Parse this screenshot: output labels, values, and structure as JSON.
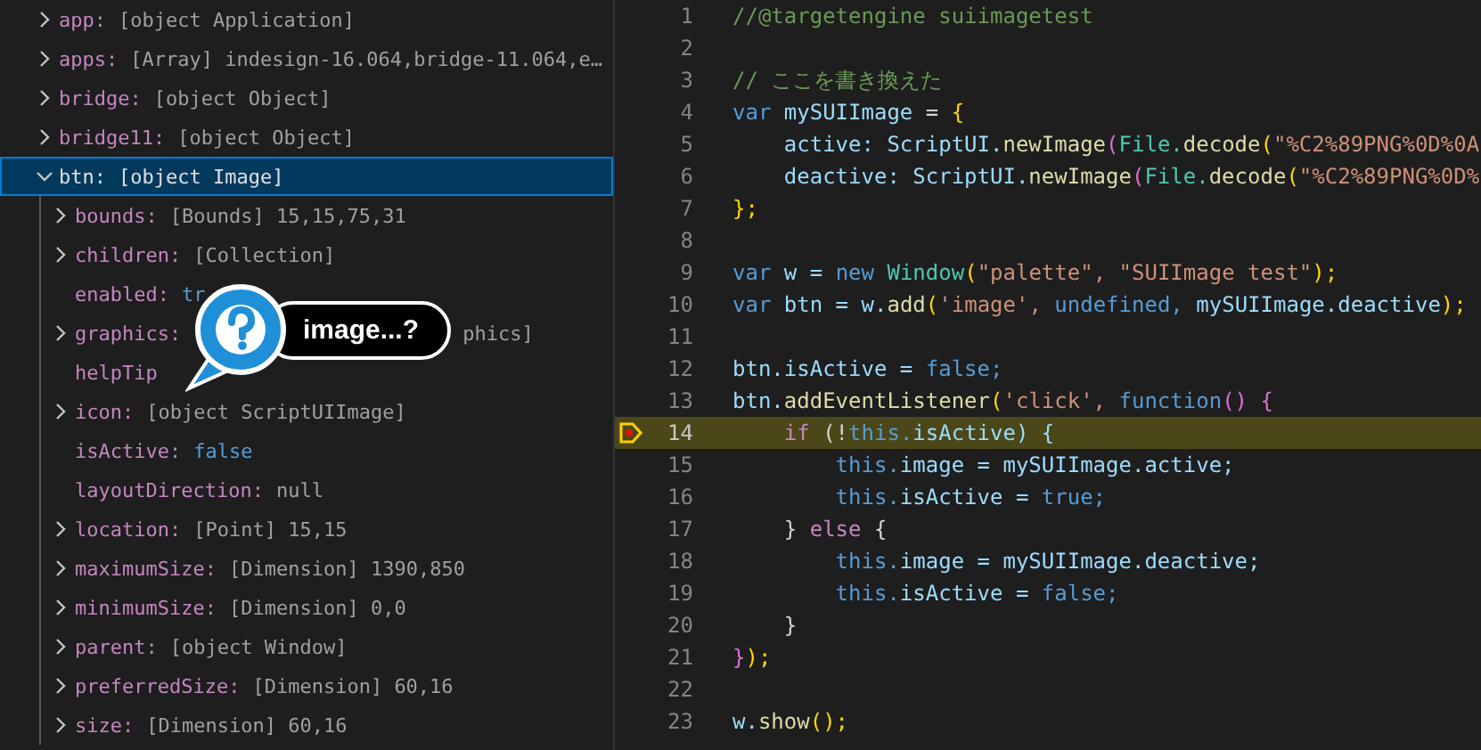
{
  "variables": [
    {
      "name": "app:",
      "value": "[object Application]",
      "expandable": true,
      "expanded": false,
      "selected": false
    },
    {
      "name": "apps:",
      "value": "[Array] indesign-16.064,bridge-11.064,e…",
      "expandable": true,
      "expanded": false,
      "selected": false
    },
    {
      "name": "bridge:",
      "value": "[object Object]",
      "expandable": true,
      "expanded": false,
      "selected": false
    },
    {
      "name": "bridge11:",
      "value": "[object Object]",
      "expandable": true,
      "expanded": false,
      "selected": false
    },
    {
      "name": "btn:",
      "value": "[object Image]",
      "expandable": true,
      "expanded": true,
      "selected": true,
      "children": [
        {
          "name": "bounds:",
          "value": "[Bounds] 15,15,75,31",
          "expandable": true,
          "kind": "text"
        },
        {
          "name": "children:",
          "value": "[Collection]",
          "expandable": true,
          "kind": "text"
        },
        {
          "name": "enabled:",
          "value": "tr",
          "expandable": false,
          "kind": "bool"
        },
        {
          "name": "graphics:",
          "value": "phics]",
          "expandable": true,
          "kind": "covered"
        },
        {
          "name": "helpTip",
          "expandable": false
        },
        {
          "name": "icon:",
          "value": "[object ScriptUIImage]",
          "expandable": true,
          "kind": "text"
        },
        {
          "name": "isActive:",
          "value": "false",
          "expandable": false,
          "kind": "bool"
        },
        {
          "name": "layoutDirection:",
          "value": "null",
          "expandable": false,
          "kind": "text"
        },
        {
          "name": "location:",
          "value": "[Point] 15,15",
          "expandable": true,
          "kind": "text"
        },
        {
          "name": "maximumSize:",
          "value": "[Dimension] 1390,850",
          "expandable": true,
          "kind": "text"
        },
        {
          "name": "minimumSize:",
          "value": "[Dimension] 0,0",
          "expandable": true,
          "kind": "text"
        },
        {
          "name": "parent:",
          "value": "[object Window]",
          "expandable": true,
          "kind": "text"
        },
        {
          "name": "preferredSize:",
          "value": "[Dimension] 60,16",
          "expandable": true,
          "kind": "text"
        },
        {
          "name": "size:",
          "value": "[Dimension] 60,16",
          "expandable": true,
          "kind": "text"
        }
      ]
    }
  ],
  "callout": {
    "text": "image...?"
  },
  "code": [
    {
      "number": "1",
      "tokens": [
        {
          "t": "//@targetengine suiimagetest",
          "kind": "comment"
        }
      ]
    },
    {
      "number": "2"
    },
    {
      "number": "3",
      "tokens": [
        {
          "t": "// ここを書き換えた",
          "kind": "comment"
        }
      ]
    },
    {
      "number": "4",
      "tokens": [
        {
          "t": "var",
          "kind": "kw"
        },
        {
          "t": " mySUIImage",
          "kind": "var"
        },
        {
          "t": " = ",
          "kind": "plain"
        },
        {
          "t": "{",
          "kind": "brace"
        }
      ]
    },
    {
      "number": "5",
      "tokens": [
        {
          "t": "    active:",
          "kind": "var"
        },
        {
          "t": " ScriptUI.",
          "kind": "var"
        },
        {
          "t": "newImage",
          "kind": "fn"
        },
        {
          "t": "(",
          "kind": "paren"
        },
        {
          "t": "File.",
          "kind": "type"
        },
        {
          "t": "decode",
          "kind": "fn"
        },
        {
          "t": "(",
          "kind": "brace"
        },
        {
          "t": "\"%C2%89PNG%0D%0A",
          "kind": "str"
        }
      ]
    },
    {
      "number": "6",
      "tokens": [
        {
          "t": "    deactive:",
          "kind": "var"
        },
        {
          "t": " ScriptUI.",
          "kind": "var"
        },
        {
          "t": "newImage",
          "kind": "fn"
        },
        {
          "t": "(",
          "kind": "paren"
        },
        {
          "t": "File.",
          "kind": "type"
        },
        {
          "t": "decode",
          "kind": "fn"
        },
        {
          "t": "(",
          "kind": "brace"
        },
        {
          "t": "\"%C2%89PNG%0D%",
          "kind": "str"
        }
      ]
    },
    {
      "number": "7",
      "tokens": [
        {
          "t": "};",
          "kind": "brace"
        }
      ]
    },
    {
      "number": "8"
    },
    {
      "number": "9",
      "tokens": [
        {
          "t": "var",
          "kind": "kw"
        },
        {
          "t": " w = ",
          "kind": "var"
        },
        {
          "t": "new",
          "kind": "kw"
        },
        {
          "t": " Window",
          "kind": "type"
        },
        {
          "t": "(",
          "kind": "brace"
        },
        {
          "t": "\"palette\",",
          "kind": "str"
        },
        {
          "t": " \"SUIImage test\"",
          "kind": "str"
        },
        {
          "t": ");",
          "kind": "brace"
        }
      ]
    },
    {
      "number": "10",
      "tokens": [
        {
          "t": "var",
          "kind": "kw"
        },
        {
          "t": " btn = w.",
          "kind": "var"
        },
        {
          "t": "add",
          "kind": "fn"
        },
        {
          "t": "(",
          "kind": "brace"
        },
        {
          "t": "'image',",
          "kind": "str"
        },
        {
          "t": " undefined,",
          "kind": "kw"
        },
        {
          "t": " mySUIImage.deactive",
          "kind": "var"
        },
        {
          "t": ");",
          "kind": "brace"
        }
      ]
    },
    {
      "number": "11"
    },
    {
      "number": "12",
      "tokens": [
        {
          "t": "btn.isActive = ",
          "kind": "var"
        },
        {
          "t": "false;",
          "kind": "kw"
        }
      ]
    },
    {
      "number": "13",
      "tokens": [
        {
          "t": "btn.",
          "kind": "var"
        },
        {
          "t": "addEventListener",
          "kind": "fn"
        },
        {
          "t": "(",
          "kind": "brace"
        },
        {
          "t": "'click',",
          "kind": "str"
        },
        {
          "t": " function",
          "kind": "kw"
        },
        {
          "t": "() {",
          "kind": "paren"
        }
      ]
    },
    {
      "number": "14",
      "current": true,
      "tokens": [
        {
          "t": "    if",
          "kind": "ctrl"
        },
        {
          "t": " (!",
          "kind": "plain"
        },
        {
          "t": "this.",
          "kind": "kw"
        },
        {
          "t": "isActive) {",
          "kind": "var"
        }
      ]
    },
    {
      "number": "15",
      "tokens": [
        {
          "t": "        this.",
          "kind": "kw"
        },
        {
          "t": "image = mySUIImage.active;",
          "kind": "var"
        }
      ]
    },
    {
      "number": "16",
      "tokens": [
        {
          "t": "        this.",
          "kind": "kw"
        },
        {
          "t": "isActive = ",
          "kind": "var"
        },
        {
          "t": "true;",
          "kind": "kw"
        }
      ]
    },
    {
      "number": "17",
      "tokens": [
        {
          "t": "    }",
          "kind": "plain"
        },
        {
          "t": " else",
          "kind": "ctrl"
        },
        {
          "t": " {",
          "kind": "plain"
        }
      ]
    },
    {
      "number": "18",
      "tokens": [
        {
          "t": "        this.",
          "kind": "kw"
        },
        {
          "t": "image = mySUIImage.deactive;",
          "kind": "var"
        }
      ]
    },
    {
      "number": "19",
      "tokens": [
        {
          "t": "        this.",
          "kind": "kw"
        },
        {
          "t": "isActive = ",
          "kind": "var"
        },
        {
          "t": "false;",
          "kind": "kw"
        }
      ]
    },
    {
      "number": "20",
      "tokens": [
        {
          "t": "    }",
          "kind": "plain"
        }
      ]
    },
    {
      "number": "21",
      "tokens": [
        {
          "t": "}",
          "kind": "paren"
        },
        {
          "t": ");",
          "kind": "brace"
        }
      ]
    },
    {
      "number": "22"
    },
    {
      "number": "23",
      "tokens": [
        {
          "t": "w.",
          "kind": "var"
        },
        {
          "t": "show",
          "kind": "fn"
        },
        {
          "t": "();",
          "kind": "brace"
        }
      ]
    }
  ]
}
